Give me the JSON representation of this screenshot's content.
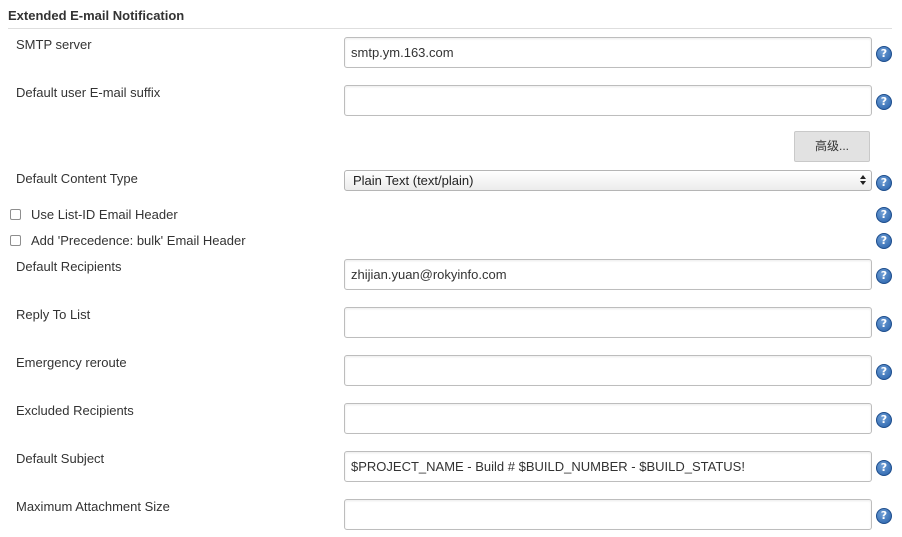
{
  "section": {
    "title": "Extended E-mail Notification"
  },
  "fields": {
    "smtp_server": {
      "label": "SMTP server",
      "value": "smtp.ym.163.com"
    },
    "default_suffix": {
      "label": "Default user E-mail suffix",
      "value": ""
    },
    "content_type": {
      "label": "Default Content Type",
      "selected": "Plain Text (text/plain)"
    },
    "default_recipients": {
      "label": "Default Recipients",
      "value": "zhijian.yuan@rokyinfo.com"
    },
    "reply_to": {
      "label": "Reply To List",
      "value": ""
    },
    "emergency_reroute": {
      "label": "Emergency reroute",
      "value": ""
    },
    "excluded_recipients": {
      "label": "Excluded Recipients",
      "value": ""
    },
    "default_subject": {
      "label": "Default Subject",
      "value": "$PROJECT_NAME - Build # $BUILD_NUMBER - $BUILD_STATUS!"
    },
    "max_attachment": {
      "label": "Maximum Attachment Size",
      "value": ""
    }
  },
  "checkboxes": {
    "list_id": {
      "label": "Use List-ID Email Header",
      "checked": false
    },
    "precedence": {
      "label": "Add 'Precedence: bulk' Email Header",
      "checked": false
    }
  },
  "buttons": {
    "advanced": "高级..."
  },
  "icons": {
    "help": "help-icon",
    "help_glyph": "?"
  },
  "colors": {
    "help_blue": "#245ea8"
  }
}
